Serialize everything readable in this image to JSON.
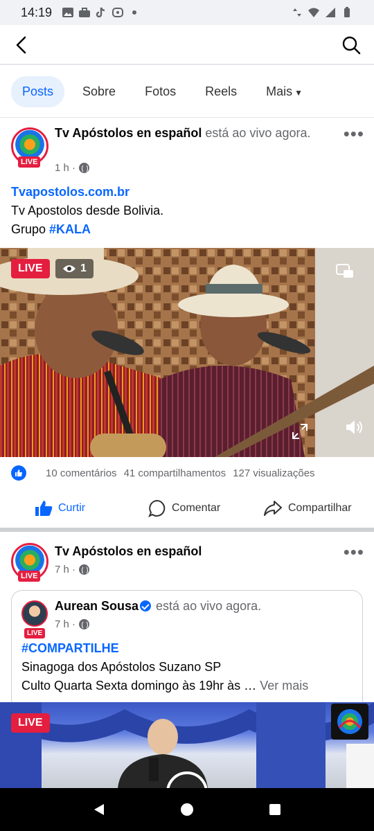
{
  "status_bar": {
    "time": "14:19"
  },
  "tabs": [
    {
      "label": "Posts"
    },
    {
      "label": "Sobre"
    },
    {
      "label": "Fotos"
    },
    {
      "label": "Reels"
    },
    {
      "label": "Mais"
    }
  ],
  "post1": {
    "author": "Tv Apóstolos en español",
    "author_suffix": " está ao vivo agora.",
    "avatar_badge": "LIVE",
    "time": "1 h ·",
    "link": "Tvapostolos.com.br",
    "line2": " Tv Apostolos desde Bolivia.",
    "line3_prefix": "Grupo ",
    "hashtag": "#KALA",
    "video_live": "LIVE",
    "viewers": "1",
    "stats": {
      "comments": "10 comentários",
      "shares": "41 compartilhamentos",
      "views": "127 visualizações"
    },
    "actions": {
      "like": "Curtir",
      "comment": "Comentar",
      "share": "Compartilhar"
    }
  },
  "post2": {
    "author": "Tv Apóstolos en español",
    "avatar_badge": "LIVE",
    "time": "7 h ·",
    "shared": {
      "author": "Aurean Sousa",
      "author_suffix": " está ao vivo agora.",
      "avatar_badge": "LIVE",
      "time": "7 h ·",
      "hashtag": "#COMPARTILHE",
      "line2": "Sinagoga dos Apóstolos Suzano SP",
      "line3": "Culto Quarta Sexta domingo às 19hr às …",
      "see_more": "Ver mais"
    },
    "video_live": "LIVE"
  },
  "colors": {
    "accent": "#0866ff",
    "live_red": "#e41e3f",
    "secondary_text": "#65676b"
  }
}
